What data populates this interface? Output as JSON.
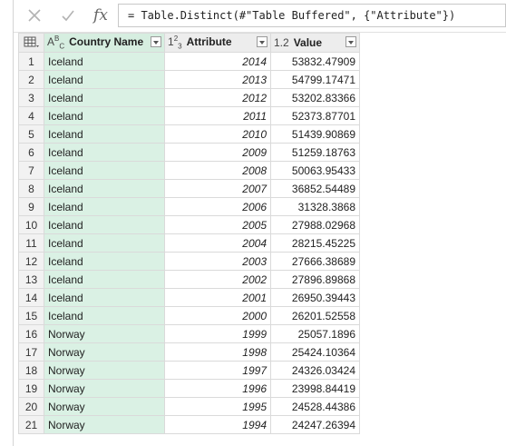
{
  "formula_bar": {
    "cancel_icon": "close-icon",
    "commit_icon": "check-icon",
    "fx_label": "fx",
    "formula": "= Table.Distinct(#\"Table Buffered\", {\"Attribute\"})"
  },
  "columns": [
    {
      "type_label": "ABC",
      "name": "Country Name"
    },
    {
      "type_label": "123",
      "name": "Attribute"
    },
    {
      "type_label": "1.2",
      "name": "Value"
    }
  ],
  "rows": [
    {
      "n": "1",
      "country": "Iceland",
      "attribute": "2014",
      "value": "53832.47909"
    },
    {
      "n": "2",
      "country": "Iceland",
      "attribute": "2013",
      "value": "54799.17471"
    },
    {
      "n": "3",
      "country": "Iceland",
      "attribute": "2012",
      "value": "53202.83366"
    },
    {
      "n": "4",
      "country": "Iceland",
      "attribute": "2011",
      "value": "52373.87701"
    },
    {
      "n": "5",
      "country": "Iceland",
      "attribute": "2010",
      "value": "51439.90869"
    },
    {
      "n": "6",
      "country": "Iceland",
      "attribute": "2009",
      "value": "51259.18763"
    },
    {
      "n": "7",
      "country": "Iceland",
      "attribute": "2008",
      "value": "50063.95433"
    },
    {
      "n": "8",
      "country": "Iceland",
      "attribute": "2007",
      "value": "36852.54489"
    },
    {
      "n": "9",
      "country": "Iceland",
      "attribute": "2006",
      "value": "31328.3868"
    },
    {
      "n": "10",
      "country": "Iceland",
      "attribute": "2005",
      "value": "27988.02968"
    },
    {
      "n": "11",
      "country": "Iceland",
      "attribute": "2004",
      "value": "28215.45225"
    },
    {
      "n": "12",
      "country": "Iceland",
      "attribute": "2003",
      "value": "27666.38689"
    },
    {
      "n": "13",
      "country": "Iceland",
      "attribute": "2002",
      "value": "27896.89868"
    },
    {
      "n": "14",
      "country": "Iceland",
      "attribute": "2001",
      "value": "26950.39443"
    },
    {
      "n": "15",
      "country": "Iceland",
      "attribute": "2000",
      "value": "26201.52558"
    },
    {
      "n": "16",
      "country": "Norway",
      "attribute": "1999",
      "value": "25057.1896"
    },
    {
      "n": "17",
      "country": "Norway",
      "attribute": "1998",
      "value": "25424.10364"
    },
    {
      "n": "18",
      "country": "Norway",
      "attribute": "1997",
      "value": "24326.03424"
    },
    {
      "n": "19",
      "country": "Norway",
      "attribute": "1996",
      "value": "23998.84419"
    },
    {
      "n": "20",
      "country": "Norway",
      "attribute": "1995",
      "value": "24528.44386"
    },
    {
      "n": "21",
      "country": "Norway",
      "attribute": "1994",
      "value": "24247.26394"
    }
  ]
}
